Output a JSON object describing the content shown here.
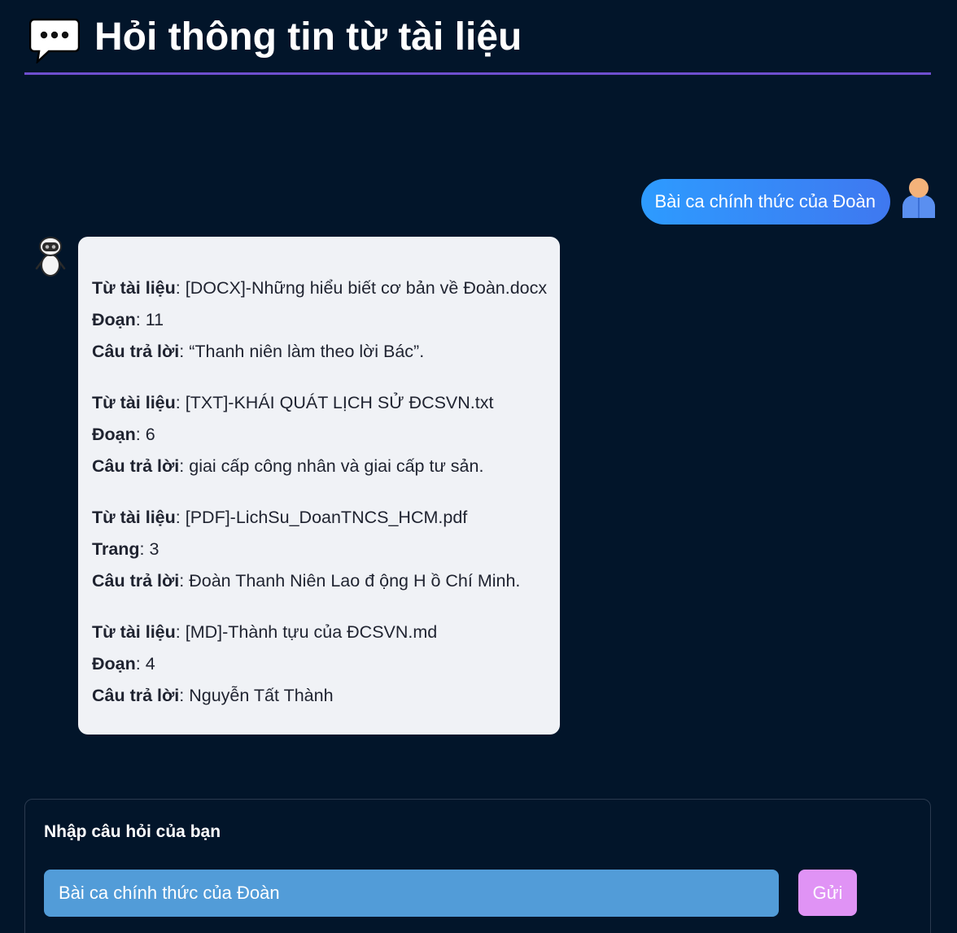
{
  "header": {
    "icon": "speech-balloon-icon",
    "title": "Hỏi thông tin từ tài liệu"
  },
  "conversation": {
    "user_message": "Bài ca chính thức của Đoàn",
    "results": [
      {
        "source_label": "Từ tài liệu",
        "source": "[DOCX]-Những hiểu biết cơ bản về Đoàn.docx",
        "loc_label": "Đoạn",
        "loc": "11",
        "answer_label": "Câu trả lời",
        "answer": "“Thanh niên làm theo lời Bác”."
      },
      {
        "source_label": "Từ tài liệu",
        "source": "[TXT]-KHÁI QUÁT LỊCH SỬ ĐCSVN.txt",
        "loc_label": "Đoạn",
        "loc": "6",
        "answer_label": "Câu trả lời",
        "answer": "giai cấp công nhân và giai cấp tư sản."
      },
      {
        "source_label": "Từ tài liệu",
        "source": "[PDF]-LichSu_DoanTNCS_HCM.pdf",
        "loc_label": "Trang",
        "loc": "3",
        "answer_label": "Câu trả lời",
        "answer": "Đoàn Thanh Niên Lao đ ộng H ồ Chí Minh."
      },
      {
        "source_label": "Từ tài liệu",
        "source": "[MD]-Thành tựu của ĐCSVN.md",
        "loc_label": "Đoạn",
        "loc": "4",
        "answer_label": "Câu trả lời",
        "answer": "Nguyễn Tất Thành"
      }
    ]
  },
  "form": {
    "label": "Nhập câu hỏi của bạn",
    "input_value": "Bài ca chính thức của Đoàn",
    "send_label": "Gửi"
  },
  "colors": {
    "background": "#02152a",
    "header_rule": "#6f4fd0",
    "user_bubble": "#2d9bff",
    "bot_bubble": "#f0f2f6",
    "input": "#529cd8",
    "send_button": "#e093f5"
  }
}
